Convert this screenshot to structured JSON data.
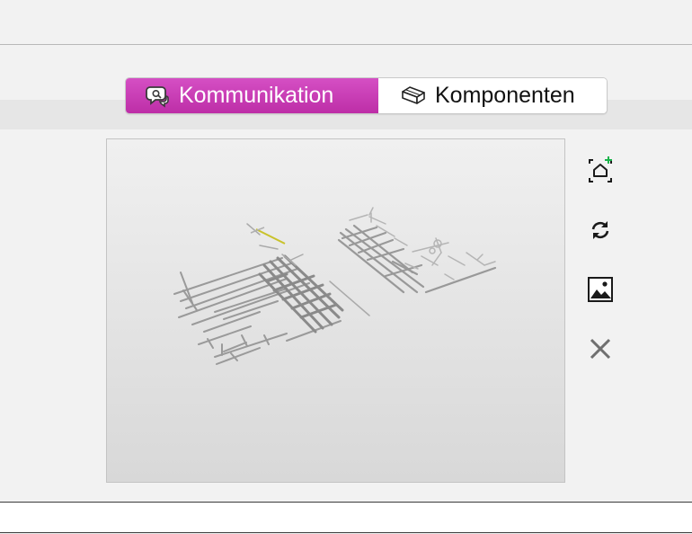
{
  "tabs": [
    {
      "label": "Kommunikation",
      "icon": "speech-bubbles-icon",
      "active": true
    },
    {
      "label": "Komponenten",
      "icon": "box-icon",
      "active": false
    }
  ],
  "colors": {
    "active_tab": "#c43aae",
    "model_highlight": "#c9c22a",
    "add_accent": "#17b34a"
  },
  "side_actions": [
    {
      "icon": "add-view-icon"
    },
    {
      "icon": "refresh-icon"
    },
    {
      "icon": "image-icon"
    },
    {
      "icon": "close-icon"
    }
  ]
}
